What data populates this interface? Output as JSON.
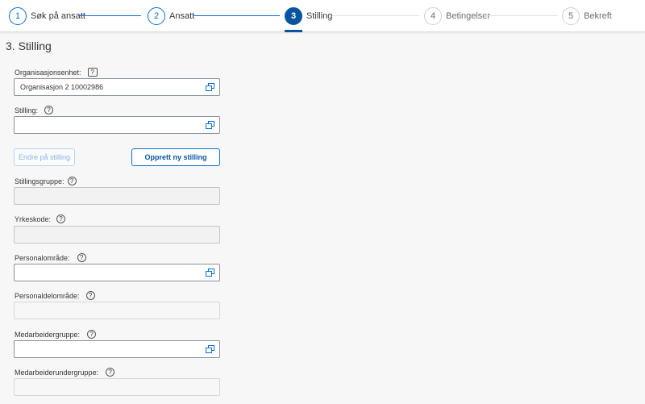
{
  "wizard": {
    "steps": [
      {
        "number": "1",
        "label": "Søk på ansatt",
        "state": "done"
      },
      {
        "number": "2",
        "label": "Ansatt",
        "state": "done"
      },
      {
        "number": "3",
        "label": "Stilling",
        "state": "current"
      },
      {
        "number": "4",
        "label": "Betingelser",
        "state": "future"
      },
      {
        "number": "5",
        "label": "Bekreft",
        "state": "future"
      }
    ]
  },
  "section": {
    "title": "3. Stilling"
  },
  "form": {
    "org_unit": {
      "label": "Organisasjonsenhet:",
      "value": "Organisasjon 2 10002986",
      "icon": "value-help-icon"
    },
    "position": {
      "label": "Stilling:",
      "value": "",
      "icon": "value-help-icon"
    },
    "buttons": {
      "edit_position": "Endre på stilling",
      "create_position": "Opprett ny stilling"
    },
    "position_group": {
      "label": "Stillingsgruppe:",
      "value": ""
    },
    "job_code": {
      "label": "Yrkeskode:",
      "value": ""
    },
    "personnel_area": {
      "label": "Personalområde:",
      "value": ""
    },
    "personnel_subarea": {
      "label": "Personaldelområde:",
      "value": ""
    },
    "employee_group": {
      "label": "Medarbeidergruppe:",
      "value": ""
    },
    "employee_subgroup": {
      "label": "Medarbeiderundergruppe:",
      "value": ""
    }
  },
  "help_glyph": "?",
  "colors": {
    "accent": "#0a6ed1",
    "current_step": "#0854a0",
    "background": "#f7f7f7"
  }
}
